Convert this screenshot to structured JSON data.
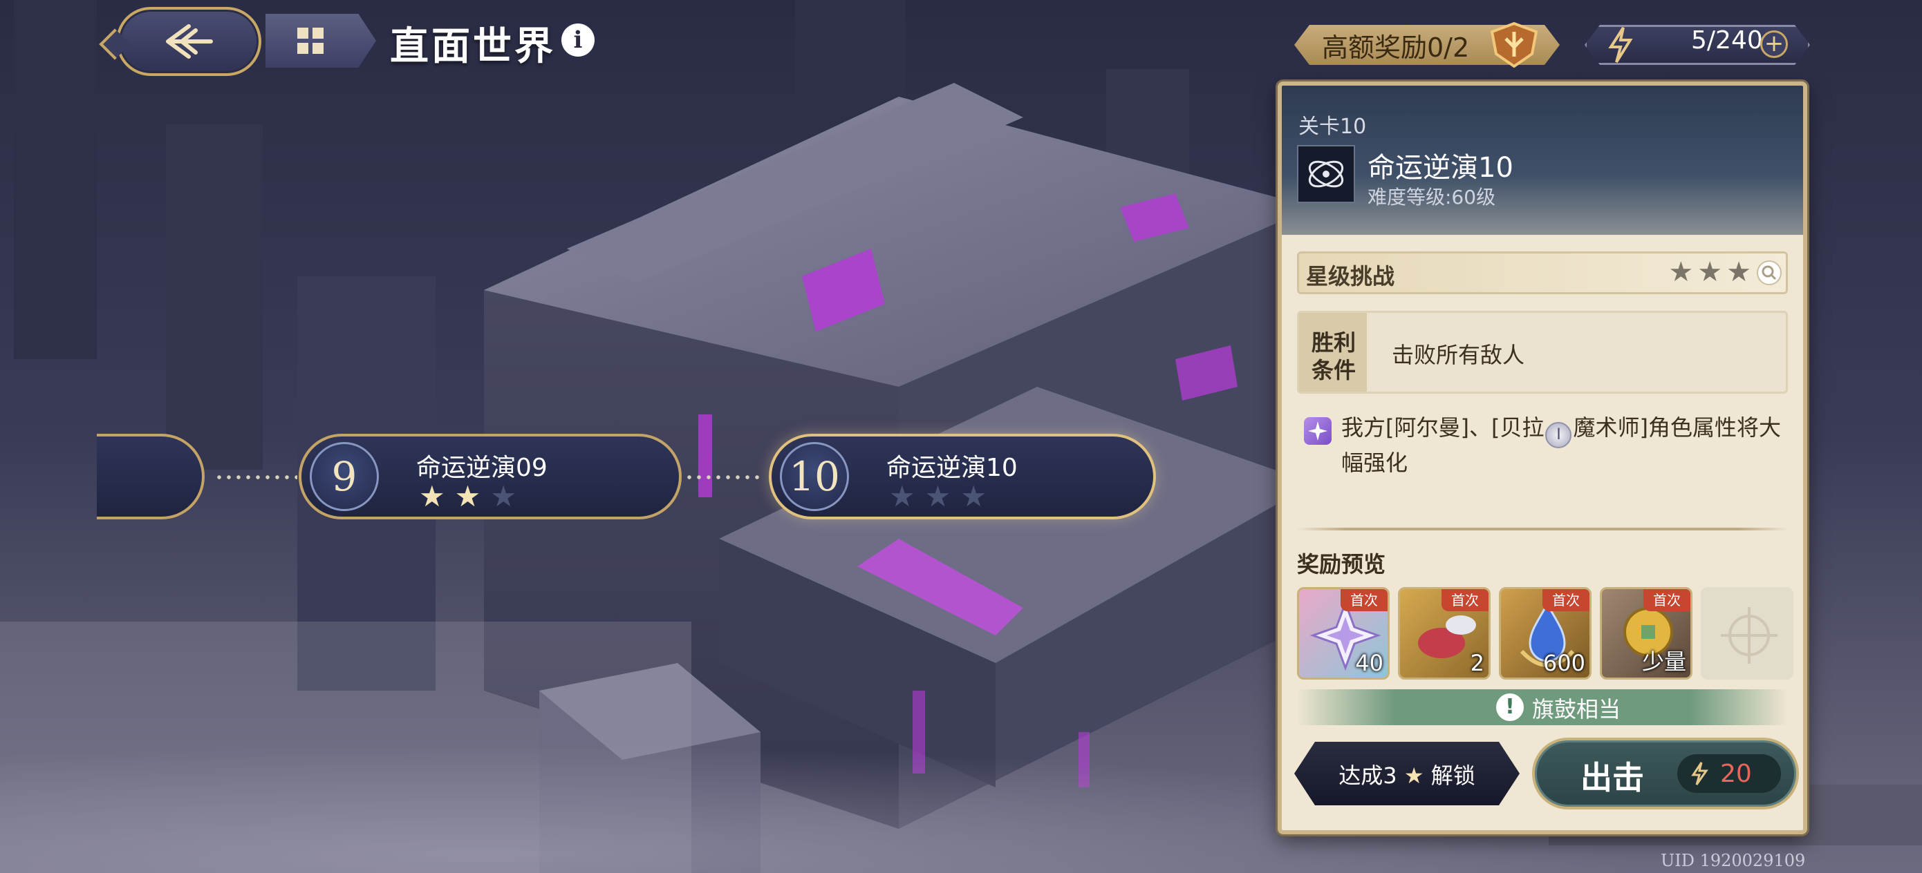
{
  "header": {
    "title": "直面世界",
    "info": "i"
  },
  "resources": {
    "high_reward": "高额奖励0/2",
    "energy": "5/240",
    "energy_plus": "+"
  },
  "stages": [
    {
      "number": "9",
      "name": "命运逆演09",
      "stars_earned": 2,
      "stars_total": 3
    },
    {
      "number": "10",
      "name": "命运逆演10",
      "stars_earned": 0,
      "stars_total": 3
    }
  ],
  "detail": {
    "level_label": "关卡10",
    "title": "命运逆演10",
    "difficulty": "难度等级:60级",
    "star_challenge": "星级挑战",
    "victory_tag_line1": "胜利",
    "victory_tag_line2": "条件",
    "victory_text": "击败所有敌人",
    "buff_part1": "我方[阿尔曼]、[贝拉",
    "buff_coin": "I",
    "buff_part2": "魔术师]角色属性将大幅强化",
    "reward_title": "奖励预览",
    "rewards": [
      {
        "qty": "40",
        "tag": "首次"
      },
      {
        "qty": "2",
        "tag": "首次"
      },
      {
        "qty": "600",
        "tag": "首次"
      },
      {
        "qty": "少量",
        "tag": "首次"
      }
    ],
    "flag_text": "旗鼓相当",
    "unlock_pre": "达成3",
    "unlock_star": "★",
    "unlock_post": "解锁",
    "go_label": "出击",
    "go_cost": "20"
  },
  "uid": "UID 1920029109",
  "colors": {
    "gold_border": "#c4a466",
    "panel_bg": "#efe6d3",
    "cost_red": "#e8675a",
    "star_on": "#f4e3b4"
  }
}
